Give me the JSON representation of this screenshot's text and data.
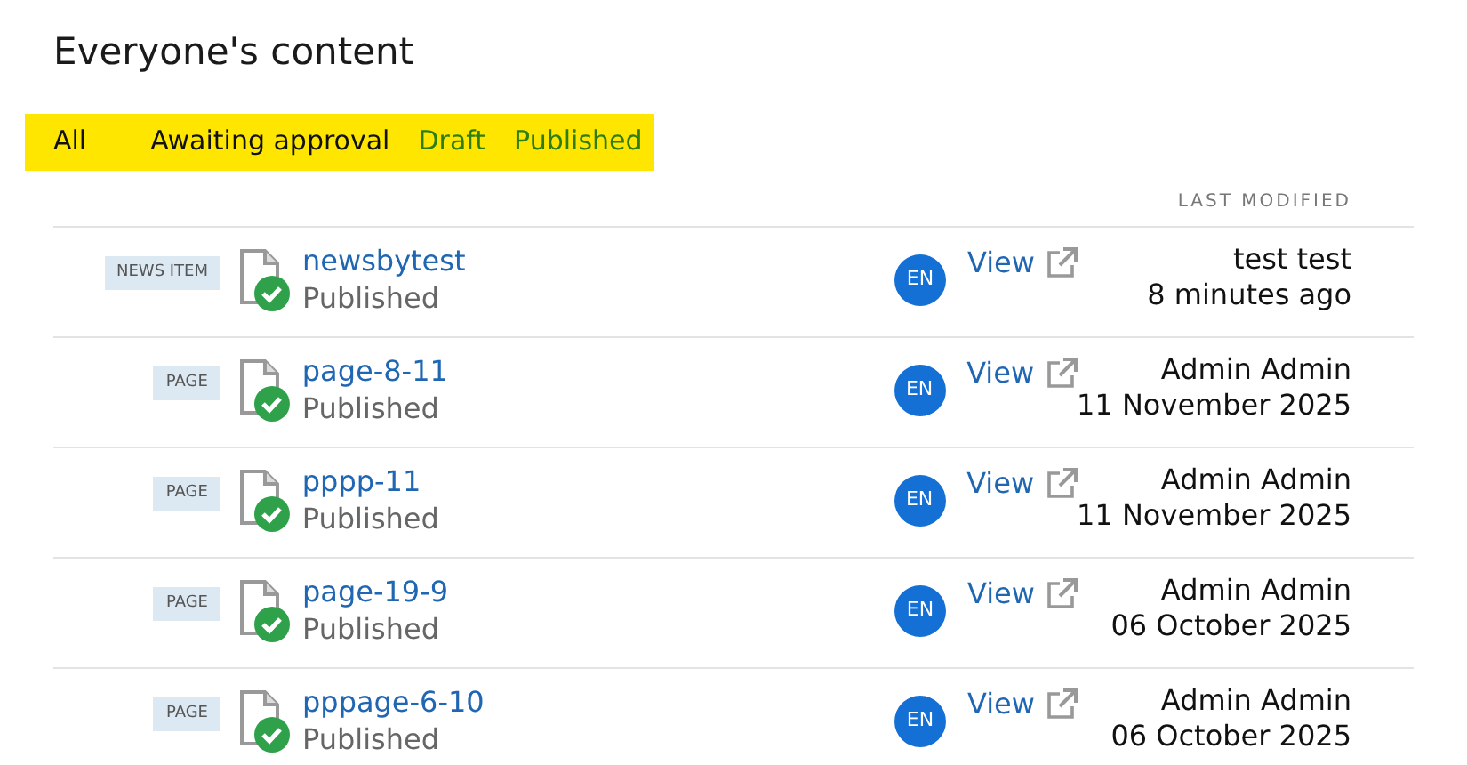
{
  "title": "Everyone's content",
  "filters": [
    {
      "label": "All",
      "color": "#111111"
    },
    {
      "label": "Awaiting approval",
      "color": "#111111"
    },
    {
      "label": "Draft",
      "color": "#2e7d12"
    },
    {
      "label": "Published",
      "color": "#2e7d12"
    }
  ],
  "columns": {
    "last_modified": "LAST MODIFIED"
  },
  "rows": [
    {
      "type": "NEWS ITEM",
      "title": "newsbytest",
      "status": "Published",
      "locale": "EN",
      "action": "View",
      "author": "test test",
      "modified": "8 minutes ago"
    },
    {
      "type": "PAGE",
      "title": "page-8-11",
      "status": "Published",
      "locale": "EN",
      "action": "View",
      "author": "Admin Admin",
      "modified": "11 November 2025"
    },
    {
      "type": "PAGE",
      "title": "pppp-11",
      "status": "Published",
      "locale": "EN",
      "action": "View",
      "author": "Admin Admin",
      "modified": "11 November 2025"
    },
    {
      "type": "PAGE",
      "title": "page-19-9",
      "status": "Published",
      "locale": "EN",
      "action": "View",
      "author": "Admin Admin",
      "modified": "06 October 2025"
    },
    {
      "type": "PAGE",
      "title": "pppage-6-10",
      "status": "Published",
      "locale": "EN",
      "action": "View",
      "author": "Admin Admin",
      "modified": "06 October 2025"
    }
  ]
}
